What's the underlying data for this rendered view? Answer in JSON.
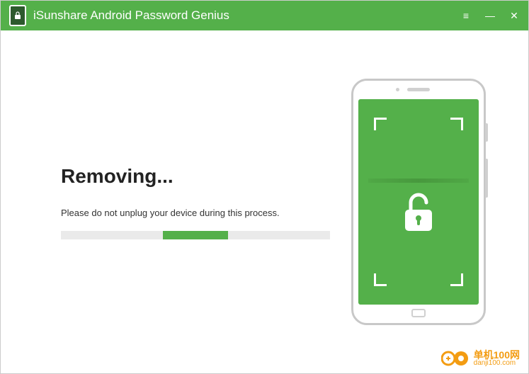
{
  "titlebar": {
    "app_name": "iSunshare Android Password Genius"
  },
  "main": {
    "heading": "Removing...",
    "subtext": "Please do not unplug your device during this process.",
    "progress_percent": 50
  },
  "watermark": {
    "cn_text": "单机100网",
    "url": "danji100.com"
  }
}
